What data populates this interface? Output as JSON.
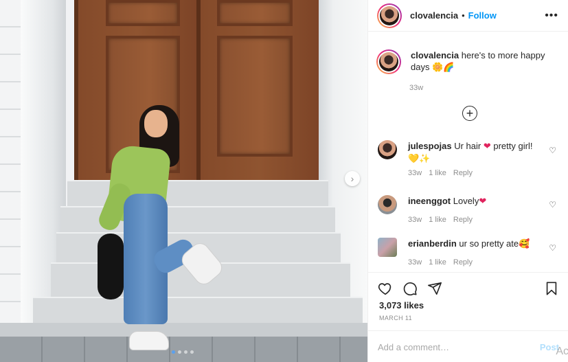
{
  "post": {
    "username": "clovalencia",
    "follow_label": "Follow",
    "separator": "•",
    "more_label": "•••"
  },
  "caption": {
    "username": "clovalencia",
    "text": "here's to more happy days",
    "emoji": "🌼🌈",
    "time": "33w"
  },
  "comments": [
    {
      "username": "julespojas",
      "text": "Ur hair",
      "emoji1": "❤",
      "text2": "pretty girl!",
      "emoji2": "💛✨",
      "time": "33w",
      "likes": "1 like",
      "reply": "Reply"
    },
    {
      "username": "ineenggot",
      "text": "Lovely",
      "emoji1": "❤",
      "time": "33w",
      "likes": "1 like",
      "reply": "Reply"
    },
    {
      "username": "erianberdin",
      "text": "ur so pretty ate",
      "emoji1": "🥰",
      "time": "33w",
      "likes": "1 like",
      "reply": "Reply"
    }
  ],
  "stats": {
    "likes": "3,073 likes",
    "date": "MARCH 11"
  },
  "add_comment": {
    "placeholder": "Add a comment…",
    "post_label": "Post"
  },
  "overlay": {
    "watermark": "Ac"
  },
  "carousel": {
    "next_label": "›"
  },
  "icons": {
    "like": "heart-icon",
    "comment": "comment-icon",
    "share": "paper-plane-icon",
    "save": "bookmark-icon",
    "load_more": "plus-circle-icon",
    "more": "more-icon"
  },
  "colors": {
    "follow": "#0095f6",
    "post_disabled": "#b2dffc",
    "text": "#262626",
    "muted": "#8e8e8e"
  }
}
